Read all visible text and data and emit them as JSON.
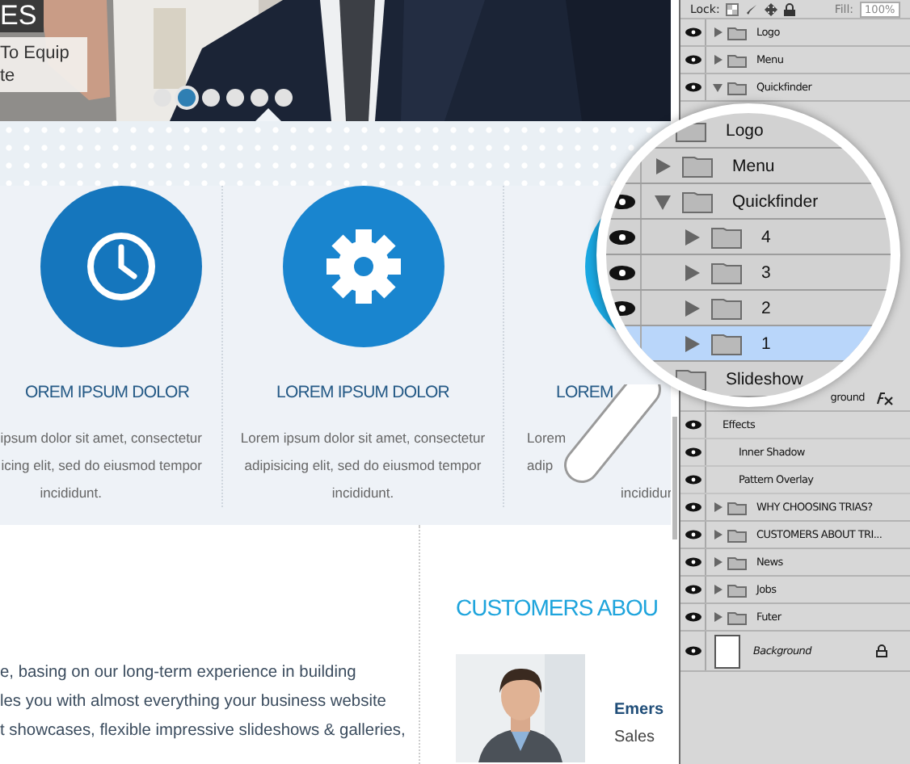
{
  "hero": {
    "badge": "ES",
    "caption": [
      "To Equip",
      "te"
    ],
    "dots": [
      {
        "selected": false
      },
      {
        "selected": true
      },
      {
        "selected": false
      },
      {
        "selected": false
      },
      {
        "selected": false
      },
      {
        "selected": false
      }
    ]
  },
  "features": [
    {
      "kind": "clock",
      "title": "OREM IPSUM DOLOR",
      "lines": [
        "ipsum dolor sit amet, consectetur",
        "icing elit, sed do eiusmod tempor",
        "incididunt."
      ]
    },
    {
      "kind": "gear",
      "title": "LOREM IPSUM DOLOR",
      "lines": [
        "Lorem ipsum dolor sit amet, consectetur",
        "adipisicing elit, sed do eiusmod tempor",
        "incididunt."
      ]
    },
    {
      "kind": "round",
      "title": "LOREM",
      "lines": [
        "Lorem",
        "adip",
        "incididur"
      ]
    }
  ],
  "about": {
    "lines": [
      "e, basing on our long-term experience in building",
      "les you with almost everything your business website",
      "t showcases, flexible impressive slideshows & galleries,"
    ]
  },
  "customers": {
    "title": "CUSTOMERS ABOU",
    "name": "Emers",
    "role": "Sales"
  },
  "layers_panel": {
    "lock_label": "Lock:",
    "fill_label": "Fill:",
    "fill_value": "100%",
    "layers": [
      {
        "name": "Logo",
        "kind": "group",
        "expanded": false,
        "visible": true
      },
      {
        "name": "Menu",
        "kind": "group",
        "expanded": false,
        "visible": true
      },
      {
        "name": "Quickfinder",
        "kind": "group",
        "expanded": true,
        "visible": true
      },
      {
        "name": "ground",
        "kind": "layer",
        "fx": true,
        "visible": false,
        "children": [
          {
            "name": "Effects",
            "kind": "effects",
            "visible": true,
            "children": [
              {
                "name": "Inner Shadow",
                "kind": "effect",
                "visible": true
              },
              {
                "name": "Pattern Overlay",
                "kind": "effect",
                "visible": true
              }
            ]
          }
        ]
      },
      {
        "name": "WHY CHOOSING TRIAS?",
        "kind": "group",
        "expanded": false,
        "visible": true
      },
      {
        "name": "CUSTOMERS ABOUT TRI...",
        "kind": "group",
        "expanded": false,
        "visible": true
      },
      {
        "name": "News",
        "kind": "group",
        "expanded": false,
        "visible": true
      },
      {
        "name": "Jobs",
        "kind": "group",
        "expanded": false,
        "visible": true
      },
      {
        "name": "Futer",
        "kind": "group",
        "expanded": false,
        "visible": true
      },
      {
        "name": "Background",
        "locked": true,
        "visible": true
      }
    ]
  },
  "magnifier": {
    "layers": [
      {
        "name": "Logo",
        "kind": "group",
        "selected": false,
        "visible": false
      },
      {
        "name": "Menu",
        "kind": "group",
        "expanded": false,
        "selected": false,
        "visible": false
      },
      {
        "name": "Quickfinder",
        "kind": "group",
        "expanded": true,
        "selected": false,
        "visible": true,
        "children": [
          {
            "name": "4",
            "kind": "group",
            "expanded": false,
            "selected": false,
            "visible": true
          },
          {
            "name": "3",
            "kind": "group",
            "expanded": false,
            "selected": false,
            "visible": true
          },
          {
            "name": "2",
            "kind": "group",
            "expanded": false,
            "selected": false,
            "visible": true
          },
          {
            "name": "1",
            "kind": "group",
            "expanded": false,
            "selected": true,
            "visible": false
          }
        ]
      },
      {
        "name": "Slideshow",
        "kind": "group",
        "selected": false,
        "visible": false
      }
    ]
  }
}
